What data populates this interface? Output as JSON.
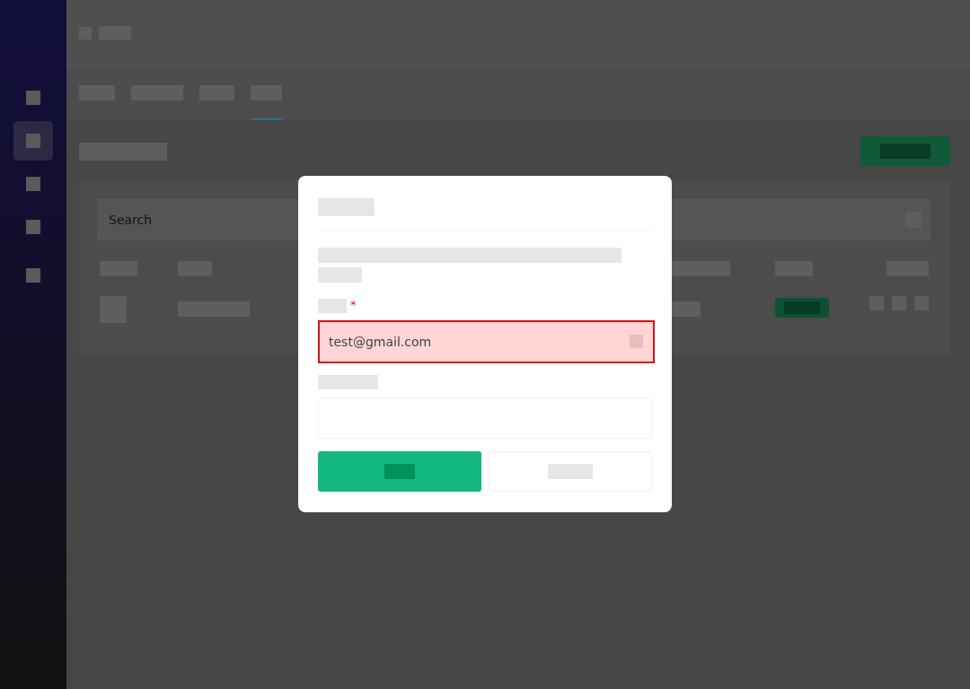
{
  "sidebar": {
    "items": [
      {
        "selected": false
      },
      {
        "selected": true
      },
      {
        "selected": false
      },
      {
        "selected": false
      },
      {
        "selected": false
      }
    ]
  },
  "tabs": [
    {
      "selected": false
    },
    {
      "selected": false
    },
    {
      "selected": false
    },
    {
      "selected": true
    }
  ],
  "search": {
    "placeholder": "Search"
  },
  "dialog": {
    "required_mark": "*",
    "email_field": {
      "value": "test@gmail.com",
      "invalid": true
    }
  }
}
